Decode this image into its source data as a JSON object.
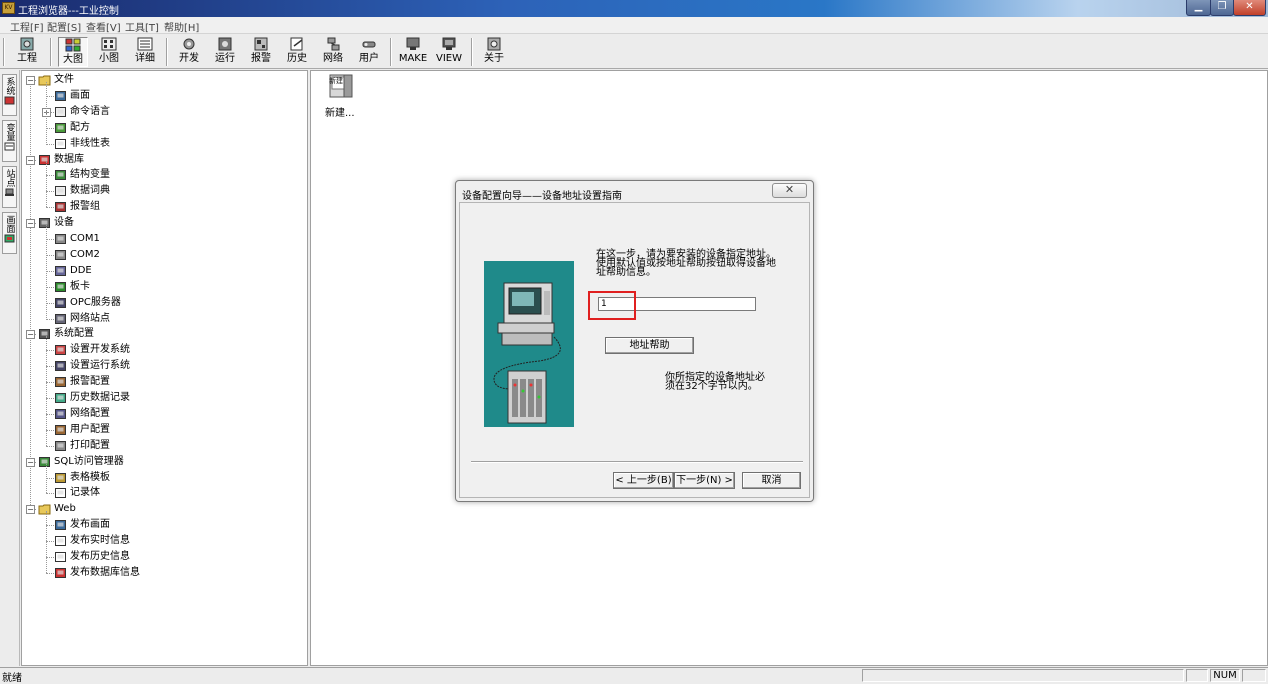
{
  "window": {
    "title": "工程浏览器---工业控制",
    "app_icon_text": "KV",
    "minimize_label": "▁",
    "maximize_label": "❐",
    "close_label": "✕"
  },
  "menu": [
    "工程[F]",
    "配置[S]",
    "查看[V]",
    "工具[T]",
    "帮助[H]"
  ],
  "toolbar": [
    {
      "label": "工程",
      "icon": "project-icon"
    },
    {
      "label": "大图",
      "icon": "large-icons-icon",
      "pressed": true
    },
    {
      "label": "小图",
      "icon": "small-icons-icon"
    },
    {
      "label": "详细",
      "icon": "details-icon"
    },
    {
      "label": "开发",
      "icon": "develop-icon"
    },
    {
      "label": "运行",
      "icon": "run-icon"
    },
    {
      "label": "报警",
      "icon": "alarm-icon"
    },
    {
      "label": "历史",
      "icon": "history-icon"
    },
    {
      "label": "网络",
      "icon": "network-icon"
    },
    {
      "label": "用户",
      "icon": "user-icon"
    },
    {
      "label": "MAKE",
      "icon": "make-icon"
    },
    {
      "label": "VIEW",
      "icon": "view-icon"
    },
    {
      "label": "关于",
      "icon": "about-icon"
    }
  ],
  "vtabs": [
    {
      "label": "系统",
      "icon": "system-icon"
    },
    {
      "label": "变量",
      "icon": "variable-icon"
    },
    {
      "label": "站点",
      "icon": "station-icon"
    },
    {
      "label": "画面",
      "icon": "picture-icon"
    }
  ],
  "tree": [
    {
      "label": "文件",
      "level": 0,
      "expander": "−",
      "icon": "folder-icon"
    },
    {
      "label": "画面",
      "level": 1,
      "icon": "screen-icon"
    },
    {
      "label": "命令语言",
      "level": 1,
      "expander": "+",
      "icon": "command-language-icon"
    },
    {
      "label": "配方",
      "level": 1,
      "icon": "recipe-icon"
    },
    {
      "label": "非线性表",
      "level": 1,
      "icon": "nonlinear-table-icon"
    },
    {
      "label": "数据库",
      "level": 0,
      "expander": "−",
      "icon": "database-icon"
    },
    {
      "label": "结构变量",
      "level": 1,
      "icon": "struct-variable-icon"
    },
    {
      "label": "数据词典",
      "level": 1,
      "icon": "data-dictionary-icon"
    },
    {
      "label": "报警组",
      "level": 1,
      "icon": "alarm-group-icon"
    },
    {
      "label": "设备",
      "level": 0,
      "expander": "−",
      "icon": "device-icon"
    },
    {
      "label": "COM1",
      "level": 1,
      "icon": "com-port-icon"
    },
    {
      "label": "COM2",
      "level": 1,
      "icon": "com-port-icon"
    },
    {
      "label": "DDE",
      "level": 1,
      "icon": "dde-icon"
    },
    {
      "label": "板卡",
      "level": 1,
      "icon": "board-card-icon"
    },
    {
      "label": "OPC服务器",
      "level": 1,
      "icon": "opc-server-icon"
    },
    {
      "label": "网络站点",
      "level": 1,
      "icon": "network-station-icon"
    },
    {
      "label": "系统配置",
      "level": 0,
      "expander": "−",
      "icon": "system-config-icon"
    },
    {
      "label": "设置开发系统",
      "level": 1,
      "icon": "dev-system-icon"
    },
    {
      "label": "设置运行系统",
      "level": 1,
      "icon": "run-system-icon"
    },
    {
      "label": "报警配置",
      "level": 1,
      "icon": "alarm-config-icon"
    },
    {
      "label": "历史数据记录",
      "level": 1,
      "icon": "history-record-icon"
    },
    {
      "label": "网络配置",
      "level": 1,
      "icon": "network-config-icon"
    },
    {
      "label": "用户配置",
      "level": 1,
      "icon": "user-config-icon"
    },
    {
      "label": "打印配置",
      "level": 1,
      "icon": "print-config-icon"
    },
    {
      "label": "SQL访问管理器",
      "level": 0,
      "expander": "−",
      "icon": "sql-manager-icon"
    },
    {
      "label": "表格模板",
      "level": 1,
      "icon": "table-template-icon"
    },
    {
      "label": "记录体",
      "level": 1,
      "icon": "record-icon"
    },
    {
      "label": "Web",
      "level": 0,
      "expander": "−",
      "icon": "folder-icon"
    },
    {
      "label": "发布画面",
      "level": 1,
      "icon": "publish-screen-icon"
    },
    {
      "label": "发布实时信息",
      "level": 1,
      "icon": "publish-realtime-icon"
    },
    {
      "label": "发布历史信息",
      "level": 1,
      "icon": "publish-history-icon"
    },
    {
      "label": "发布数据库信息",
      "level": 1,
      "icon": "publish-database-icon"
    }
  ],
  "main": {
    "new_item_label": "新建...",
    "new_item_icon_text": "新建"
  },
  "dialog": {
    "title": "设备配置向导——设备地址设置指南",
    "close_label": "✕",
    "instruction_lines": [
      "在这一步，请为要安装的设备指定地址。",
      "使用默认值或按地址帮助按钮取得设备地",
      "址帮助信息。"
    ],
    "address_value": "1",
    "address_help_button": "地址帮助",
    "note_lines": [
      "你所指定的设备地址必",
      "须在32个字节以内。"
    ],
    "back_button": "< 上一步(B)",
    "next_button": "下一步(N) >",
    "cancel_button": "取消",
    "highlight_color": "#e02020",
    "illustration_bg": "#1f8a8a"
  },
  "statusbar": {
    "status_text": "就绪",
    "num_indicator": "NUM"
  }
}
